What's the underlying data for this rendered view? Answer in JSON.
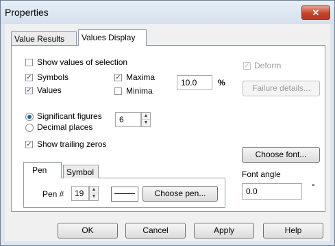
{
  "window": {
    "title": "Properties",
    "close_glyph": "✕"
  },
  "tabs": [
    {
      "label": "Value Results",
      "active": false
    },
    {
      "label": "Values Display",
      "active": true
    }
  ],
  "options": {
    "show_values_of_selection": {
      "label": "Show values of selection",
      "checked": false
    },
    "symbols": {
      "label": "Symbols",
      "checked": true
    },
    "values": {
      "label": "Values",
      "checked": true
    },
    "maxima": {
      "label": "Maxima",
      "checked": true
    },
    "minima": {
      "label": "Minima",
      "checked": false
    },
    "deform": {
      "label": "Deform",
      "checked": true,
      "enabled": false
    },
    "show_trailing_zeros": {
      "label": "Show trailing zeros",
      "checked": true
    }
  },
  "scale": {
    "value": "10.0",
    "unit": "%"
  },
  "failure_details_label": "Failure details...",
  "precision": {
    "significant_figures_label": "Significant figures",
    "decimal_places_label": "Decimal places",
    "selected": "significant_figures",
    "value": "6"
  },
  "choose_font_label": "Choose font...",
  "font_angle": {
    "label": "Font angle",
    "value": "0.0",
    "unit": "°"
  },
  "pen_tabs": [
    {
      "label": "Pen",
      "active": true
    },
    {
      "label": "Symbol",
      "active": false
    }
  ],
  "pen": {
    "label": "Pen #",
    "value": "19",
    "choose_label": "Choose pen..."
  },
  "buttons": {
    "ok": "OK",
    "cancel": "Cancel",
    "apply": "Apply",
    "help": "Help"
  },
  "spin_glyphs": {
    "up": "▲",
    "down": "▼"
  },
  "check_glyph": "✓",
  "colors": {
    "close_button": "#c2442a",
    "window_frame": "#dde6f0",
    "radio_dot": "#2a5da8"
  },
  "icons": [
    "close-icon",
    "spin-up-icon",
    "spin-down-icon",
    "check-icon"
  ]
}
